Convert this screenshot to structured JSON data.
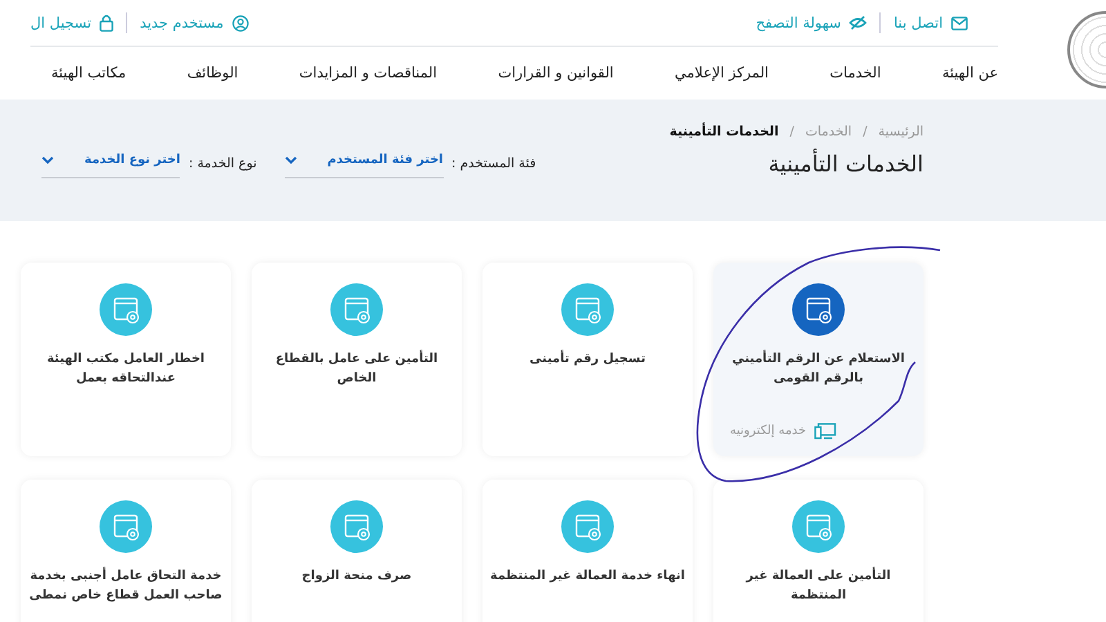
{
  "top_bar": {
    "right_links": [
      {
        "label": "اتصل بنا"
      },
      {
        "label": "سهولة التصفح"
      }
    ],
    "left_links": [
      {
        "label": "مستخدم جديد"
      },
      {
        "label": "تسجيل ال"
      }
    ]
  },
  "nav": [
    "عن الهيئة",
    "الخدمات",
    "المركز الإعلامي",
    "القوانين و القرارات",
    "المناقصات و المزايدات",
    "الوظائف",
    "مكاتب الهيئة"
  ],
  "breadcrumb": [
    {
      "label": "الرئيسية",
      "current": false
    },
    {
      "label": "الخدمات",
      "current": false
    },
    {
      "label": "الخدمات التأمينية",
      "current": true
    }
  ],
  "breadcrumb_separator": "/",
  "page_title": "الخدمات التأمينية",
  "filters": [
    {
      "label": "فئة المستخدم :",
      "value": "اختر فئة المستخدم"
    },
    {
      "label": "نوع الخدمة :",
      "value": "اختر نوع الخدمة"
    }
  ],
  "cards": [
    {
      "title": "الاستعلام عن الرقم التأميني بالرقم القومى",
      "selected": true,
      "tag": "خدمه إلكترونيه"
    },
    {
      "title": "تسجيل رقم تأمينى",
      "selected": false
    },
    {
      "title": "التأمين على عامل بالقطاع الخاص",
      "selected": false
    },
    {
      "title": "اخطار العامل مكتب الهيئة عندالتحاقه بعمل",
      "selected": false
    },
    {
      "title": "التأمين على العمالة غير المنتظمة",
      "selected": false
    },
    {
      "title": "انهاء خدمة العمالة غير المنتظمة",
      "selected": false
    },
    {
      "title": "صرف منحة الزواج",
      "selected": false
    },
    {
      "title": "خدمة التحاق عامل أجنبى بخدمة صاحب العمل قطاع خاص نمطى",
      "selected": false
    }
  ],
  "annotation": {
    "kind": "freehand"
  }
}
